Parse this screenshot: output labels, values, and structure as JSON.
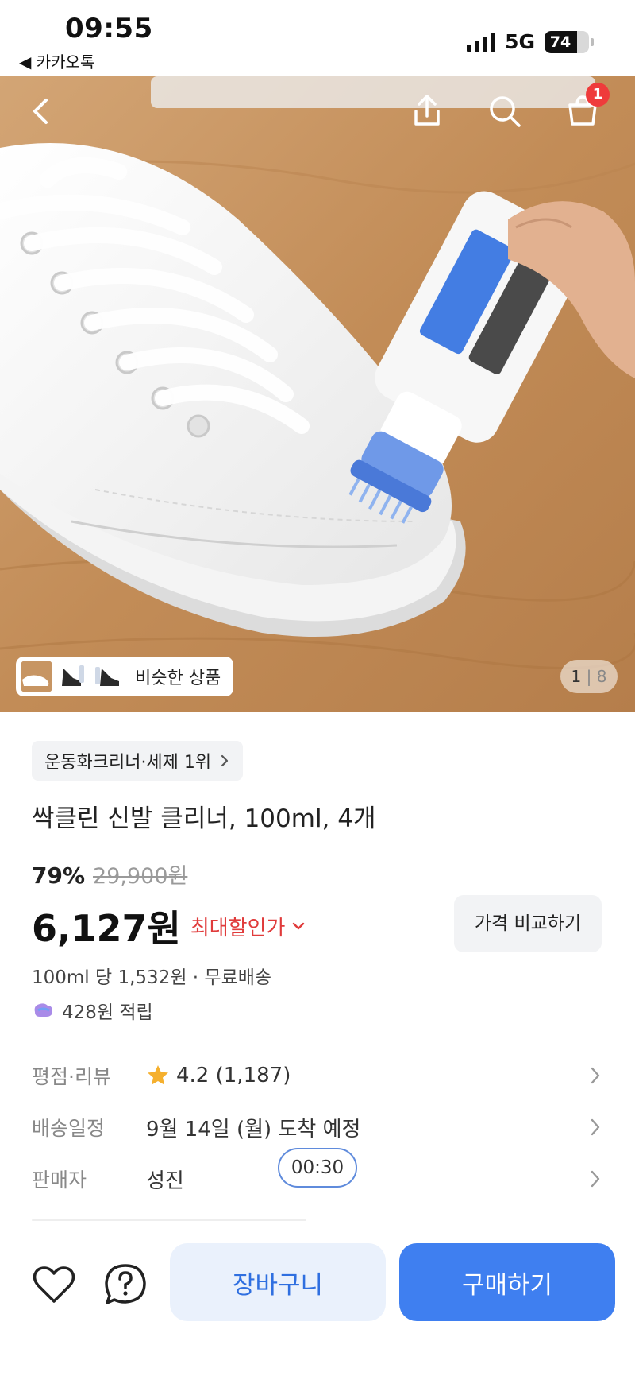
{
  "status_bar": {
    "time": "09:55",
    "back_app": "◀ 카카오톡",
    "network": "5G",
    "battery": "74",
    "battery_level": 0.74
  },
  "hero": {
    "similar_label": "비슷한 상품",
    "page_current": "1",
    "page_total": "8",
    "cart_badge": "1",
    "icons": {
      "back": "back-chevron-icon",
      "share": "share-icon",
      "search": "search-icon",
      "cart": "cart-icon"
    }
  },
  "product": {
    "rank_chip": "운동화크리너·세제 1위",
    "title": "싹클린 신발 클리너, 100ml, 4개",
    "discount_rate": "79%",
    "original_price": "29,900원",
    "price": "6,127원",
    "max_discount_label": "최대할인가",
    "compare_label": "가격 비교하기",
    "unit_price": "100ml 당 1,532원 · 무료배송",
    "points": "428원 적립"
  },
  "info_rows": [
    {
      "label": "평점·리뷰",
      "value": "4.2 (1,187)"
    },
    {
      "label": "배송일정",
      "value": "9월 14일 (월) 도착 예정"
    },
    {
      "label": "판매자",
      "value": "성진"
    }
  ],
  "timer": "00:30",
  "bottom_bar": {
    "cart_label": "장바구니",
    "buy_label": "구매하기"
  },
  "colors": {
    "accent_blue": "#3f7ff0",
    "discount_red": "#e03b3b",
    "star": "#f5b02e"
  }
}
